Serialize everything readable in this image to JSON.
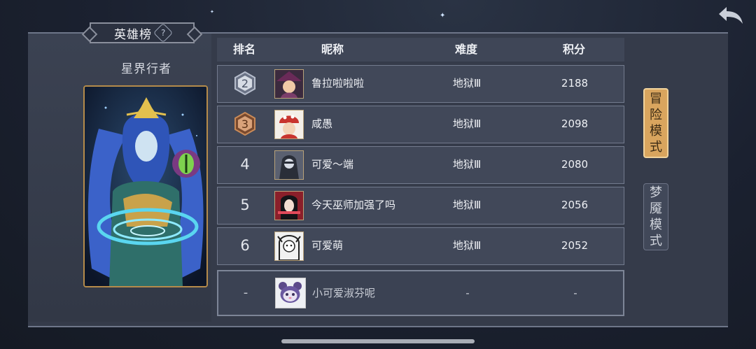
{
  "leaderboard_title": "英雄榜",
  "help_icon_glyph": "?",
  "hero": {
    "name": "星界行者"
  },
  "columns": {
    "rank": "排名",
    "nickname": "昵称",
    "difficulty": "难度",
    "score": "积分"
  },
  "rows": [
    {
      "rank": "2",
      "nickname": "鲁拉啦啦啦",
      "difficulty": "地狱Ⅲ",
      "score": "2188"
    },
    {
      "rank": "3",
      "nickname": "咸愚",
      "difficulty": "地狱Ⅲ",
      "score": "2098"
    },
    {
      "rank": "4",
      "nickname": "可爱～端",
      "difficulty": "地狱Ⅲ",
      "score": "2080"
    },
    {
      "rank": "5",
      "nickname": "今天巫师加强了吗",
      "difficulty": "地狱Ⅲ",
      "score": "2056"
    },
    {
      "rank": "6",
      "nickname": "可爱萌",
      "difficulty": "地狱Ⅲ",
      "score": "2052"
    }
  ],
  "self_row": {
    "rank": "-",
    "nickname": "小可爱淑芬呢",
    "difficulty": "-",
    "score": "-"
  },
  "modes": [
    {
      "label": [
        "冒",
        "险",
        "模",
        "式"
      ],
      "active": true
    },
    {
      "label": [
        "梦",
        "魇",
        "模",
        "式"
      ],
      "active": false
    }
  ],
  "colors": {
    "accent_gold": "#d9a55e",
    "panel": "#353b4a",
    "row": "#414859",
    "silver_medal": "#8e97aa",
    "bronze_medal": "#b0744a"
  }
}
